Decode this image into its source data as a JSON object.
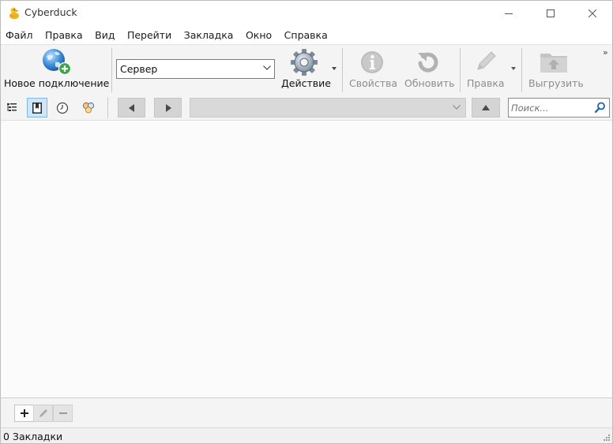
{
  "window": {
    "title": "Cyberduck",
    "controls": {
      "minimize": "minimize-icon",
      "maximize": "maximize-icon",
      "close": "close-icon"
    }
  },
  "menu": {
    "items": [
      {
        "label": "Файл"
      },
      {
        "label": "Правка"
      },
      {
        "label": "Вид"
      },
      {
        "label": "Перейти"
      },
      {
        "label": "Закладка"
      },
      {
        "label": "Окно"
      },
      {
        "label": "Справка"
      }
    ]
  },
  "toolbar": {
    "new_connection_label": "Новое подключение",
    "server_value": "Сервер",
    "action_label": "Действие",
    "properties_label": "Свойства",
    "refresh_label": "Обновить",
    "edit_label": "Правка",
    "upload_label": "Выгрузить",
    "overflow_glyph": "»"
  },
  "navigation": {
    "path_value": "",
    "search_placeholder": "Поиск..."
  },
  "bookmarks": {
    "items": []
  },
  "status": {
    "text": "0 Закладки"
  },
  "colors": {
    "accent_toggle_bg": "#cde6fb",
    "accent_toggle_border": "#7db8ea",
    "search_icon": "#1f5fa8"
  }
}
